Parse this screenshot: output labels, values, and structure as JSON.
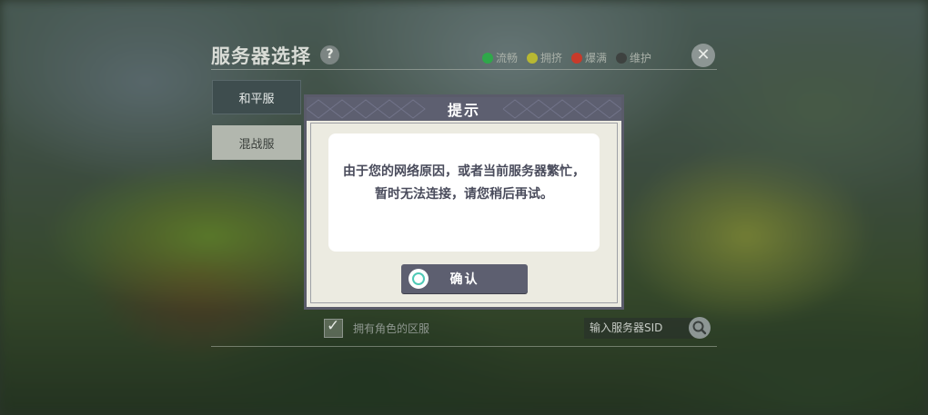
{
  "panel": {
    "title": "服务器选择",
    "help": "?",
    "legend": [
      {
        "label": "流畅",
        "color": "#2fa84a"
      },
      {
        "label": "拥挤",
        "color": "#b8b832"
      },
      {
        "label": "爆满",
        "color": "#c83a2a"
      },
      {
        "label": "维护",
        "color": "#3e4240"
      }
    ],
    "tabs": [
      {
        "label": "和平服",
        "selected": true
      },
      {
        "label": "混战服",
        "selected": false
      }
    ],
    "filter_label": "拥有角色的区服",
    "sid_placeholder": "输入服务器SID"
  },
  "dialog": {
    "title": "提示",
    "message": "由于您的网络原因，或者当前服务器繁忙，暂时无法连接，请您稍后再试。",
    "confirm_label": "确认"
  }
}
